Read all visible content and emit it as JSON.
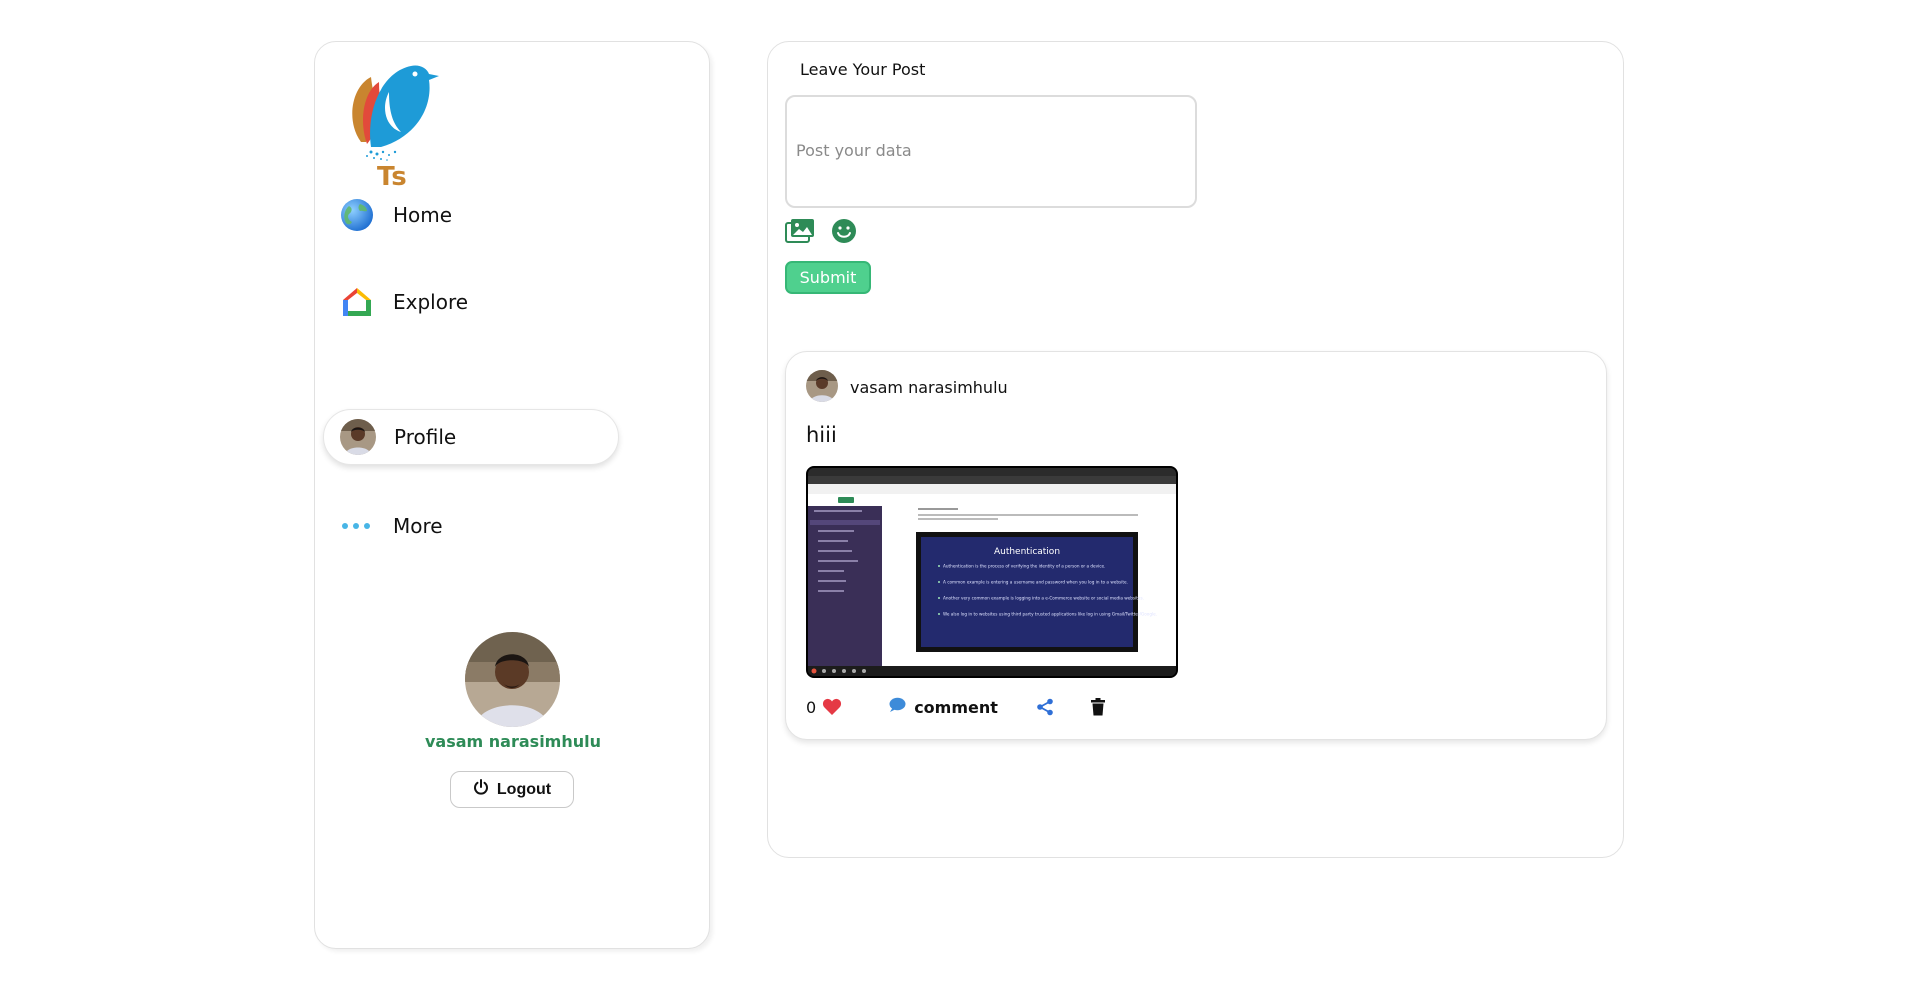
{
  "brand": {
    "logo_text": "Ts"
  },
  "sidebar": {
    "items": [
      {
        "label": "Home",
        "icon": "globe-icon"
      },
      {
        "label": "Explore",
        "icon": "google-home-icon"
      },
      {
        "label": "Profile",
        "icon": "profile-avatar"
      },
      {
        "label": "More",
        "icon": "more-dots-icon"
      }
    ],
    "active_item": "Profile",
    "user": {
      "name": "vasam narasimhulu"
    },
    "logout_label": "Logout"
  },
  "composer": {
    "heading": "Leave Your Post",
    "placeholder": "Post your data",
    "submit_label": "Submit",
    "tools": [
      "image-upload-icon",
      "emoji-icon"
    ]
  },
  "post": {
    "author": "vasam narasimhulu",
    "text": "hiii",
    "likes": "0",
    "comment_label": "comment",
    "image": {
      "slide_title": "Authentication",
      "bullets": [
        "Authentication is the process of verifying the identity of a person or a device.",
        "A common example is entering a username and password when you log in to a website.",
        "Another very common example is logging into a e-Commerce website or social media websites.",
        "We also log in to websites using third party trusted applications like log in using Gmail/Twitter/Google."
      ]
    }
  },
  "colors": {
    "accent_green": "#4fd08e",
    "username_green": "#2e8b57",
    "logo_orange": "#c9852f",
    "heart_red": "#e53945"
  }
}
